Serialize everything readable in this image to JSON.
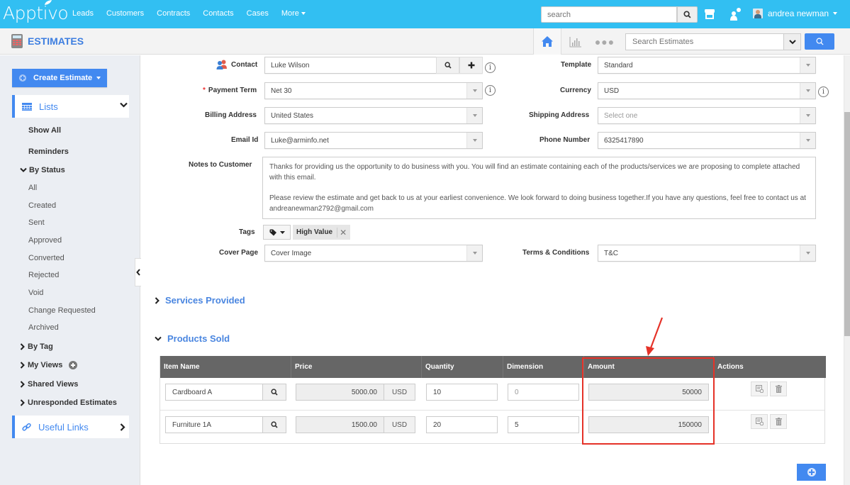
{
  "app": {
    "logo": "Apptivo",
    "nav": [
      "Leads",
      "Customers",
      "Contracts",
      "Contacts",
      "Cases",
      "More"
    ],
    "global_search_placeholder": "search",
    "user_name": "andrea newman",
    "module_title": "ESTIMATES",
    "estimates_search_placeholder": "Search Estimates",
    "more_dots": "●●●"
  },
  "sidebar": {
    "create_label": "Create Estimate",
    "lists_label": "Lists",
    "show_all": "Show All",
    "reminders": "Reminders",
    "by_status": "By Status",
    "statuses": [
      "All",
      "Created",
      "Sent",
      "Approved",
      "Converted",
      "Rejected",
      "Void",
      "Change Requested",
      "Archived"
    ],
    "by_tag": "By Tag",
    "my_views": "My Views",
    "shared_views": "Shared Views",
    "unresponded": "Unresponded Estimates",
    "useful_links": "Useful Links"
  },
  "form": {
    "contact": {
      "label": "Contact",
      "value": "Luke Wilson"
    },
    "payment_term": {
      "label": "Payment Term",
      "value": "Net 30",
      "required_mark": "*"
    },
    "billing_address": {
      "label": "Billing Address",
      "value": "United States"
    },
    "email": {
      "label": "Email Id",
      "value": "Luke@arminfo.net"
    },
    "template": {
      "label": "Template",
      "value": "Standard"
    },
    "currency": {
      "label": "Currency",
      "value": "USD"
    },
    "shipping_address": {
      "label": "Shipping Address",
      "placeholder": "Select one"
    },
    "phone": {
      "label": "Phone Number",
      "value": "6325417890"
    },
    "notes": {
      "label": "Notes to Customer",
      "paragraph1": "Thanks for providing us the opportunity to do business with you. You will find an estimate containing each of the products/services we are proposing to complete attached with this email.",
      "paragraph2": "Please review the estimate and get back to us at your earliest convenience. We look forward to doing business together.If you have any questions, feel free to contact us at andreanewman2792@gmail.com"
    },
    "tags": {
      "label": "Tags",
      "chips": [
        "High Value"
      ],
      "remove": "✕"
    },
    "cover_page": {
      "label": "Cover Page",
      "value": "Cover Image"
    },
    "terms": {
      "label": "Terms & Conditions",
      "value": "T&C"
    },
    "info_glyph": "i"
  },
  "sections": {
    "services": "Services Provided",
    "products": "Products Sold"
  },
  "products_table": {
    "columns": [
      "Item Name",
      "Price",
      "Quantity",
      "Dimension",
      "Amount",
      "Actions"
    ],
    "rows": [
      {
        "item": "Cardboard A",
        "price": "5000.00",
        "currency": "USD",
        "quantity": "10",
        "dimension": "",
        "dimension_placeholder": "0",
        "amount": "50000"
      },
      {
        "item": "Furniture 1A",
        "price": "1500.00",
        "currency": "USD",
        "quantity": "20",
        "dimension": "5",
        "dimension_placeholder": "",
        "amount": "150000"
      }
    ]
  },
  "annotation": {
    "color": "#e53228",
    "highlighted_column": "Amount"
  },
  "colors": {
    "topbar": "#32bff2",
    "accent": "#4289f0",
    "table_header": "#666666"
  }
}
